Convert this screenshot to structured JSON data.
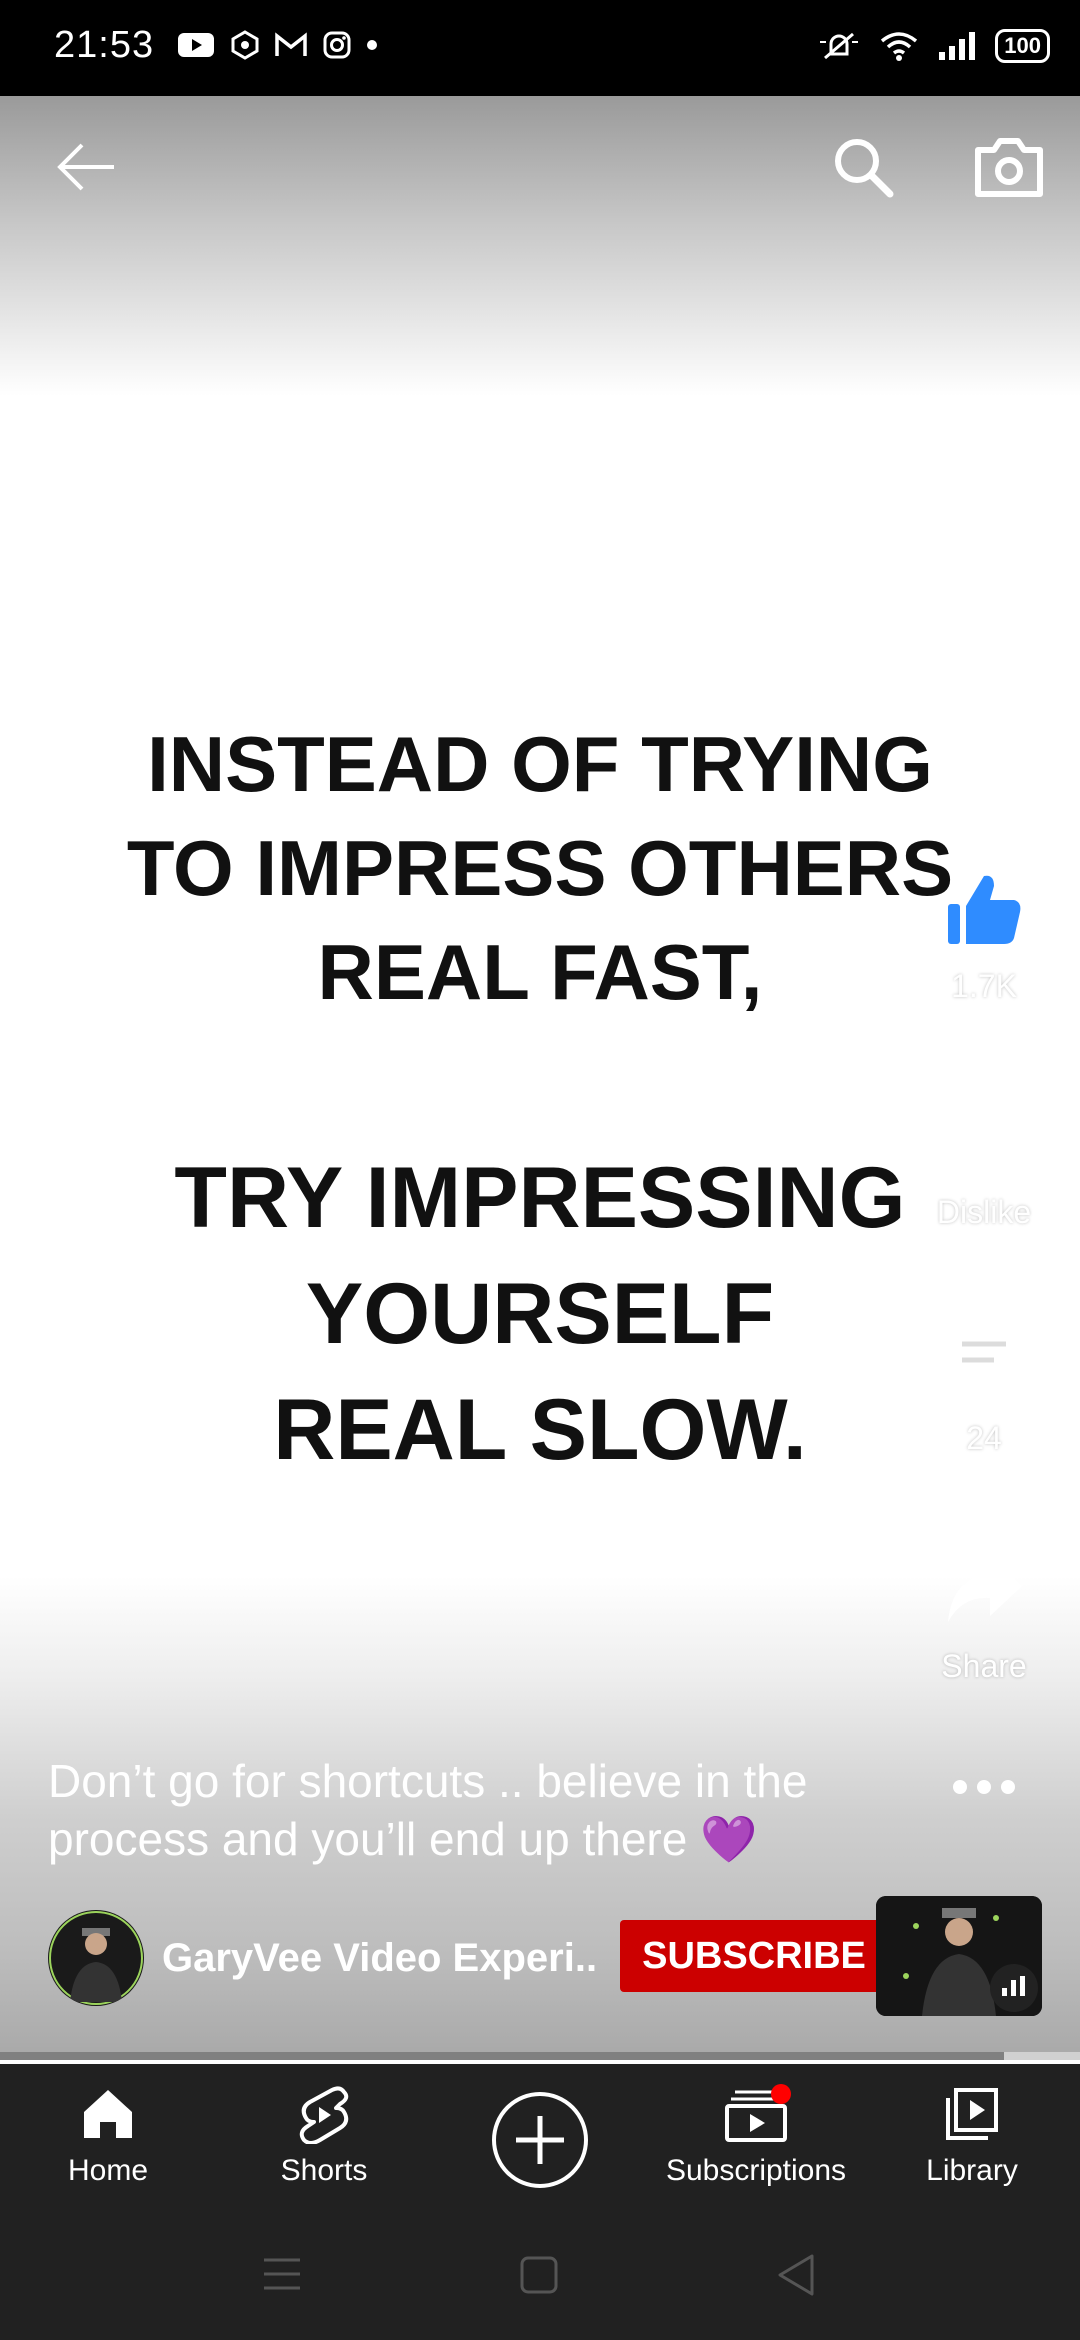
{
  "status_bar": {
    "time": "21:53",
    "battery": "100",
    "left_icons": [
      "youtube-icon",
      "hexagon-app-icon",
      "gmail-icon",
      "instagram-icon",
      "dot-icon"
    ],
    "right_icons": [
      "mute-bell-icon",
      "wifi-icon",
      "signal-icon",
      "battery-icon"
    ]
  },
  "top_bar": {
    "icons": [
      "back-arrow-icon",
      "search-icon",
      "camera-icon"
    ]
  },
  "video": {
    "quote_part1": [
      "INSTEAD OF TRYING",
      "TO IMPRESS OTHERS",
      "REAL FAST,"
    ],
    "quote_part2": [
      "TRY IMPRESSING",
      "YOURSELF",
      "REAL SLOW."
    ]
  },
  "actions": {
    "like_count": "1.7K",
    "dislike_label": "Dislike",
    "comment_count": "24",
    "share_label": "Share"
  },
  "caption": "Don’t go for shortcuts .. believe in the process and you’ll end up there 💜",
  "channel": {
    "name": "GaryVee Video Experi..",
    "subscribe_label": "SUBSCRIBE"
  },
  "progress": {
    "fraction": 0.93
  },
  "nav": {
    "items": [
      {
        "label": "Home",
        "icon": "home-icon"
      },
      {
        "label": "Shorts",
        "icon": "shorts-icon"
      },
      {
        "label": "",
        "icon": "create-plus-icon"
      },
      {
        "label": "Subscriptions",
        "icon": "subscriptions-icon"
      },
      {
        "label": "Library",
        "icon": "library-icon"
      }
    ]
  },
  "colors": {
    "accent_like": "#2f8cff",
    "subscribe_red": "#cc0000",
    "navbar_bg": "#212121",
    "notification_dot": "#ff0000"
  }
}
